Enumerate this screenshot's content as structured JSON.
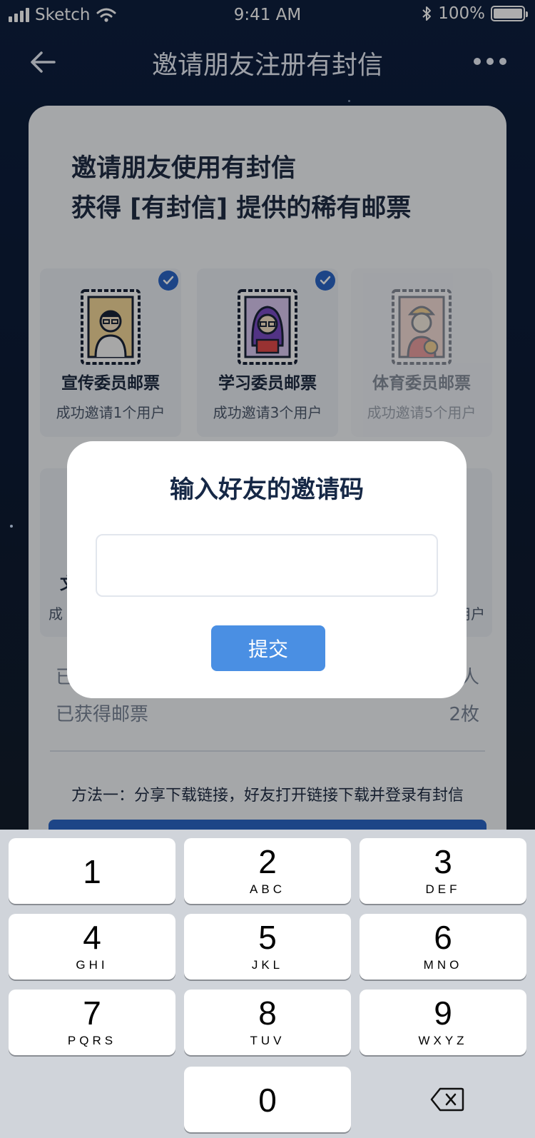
{
  "status_bar": {
    "carrier": "Sketch",
    "time": "9:41 AM",
    "battery": "100%"
  },
  "nav": {
    "title": "邀请朋友注册有封信"
  },
  "card": {
    "headline_line1": "邀请朋友使用有封信",
    "headline_line2": "获得 [有封信] 提供的稀有邮票",
    "stamps": [
      {
        "name": "宣传委员邮票",
        "condition": "成功邀请1个用户",
        "unlocked": true
      },
      {
        "name": "学习委员邮票",
        "condition": "成功邀请3个用户",
        "unlocked": true
      },
      {
        "name": "体育委员邮票",
        "condition": "成功邀请5个用户",
        "unlocked": false
      }
    ],
    "second_row_partial": {
      "left_name_fragment": "文",
      "left_cond_fragment": "成",
      "right_cond_fragment": "用户"
    },
    "stats": [
      {
        "label": "已",
        "value": "人"
      },
      {
        "label": "已获得邮票",
        "value": "2枚"
      }
    ],
    "method_one": "方法一：分享下载链接，好友打开链接下载并登录有封信"
  },
  "dialog": {
    "title": "输入好友的邀请码",
    "input_value": "",
    "submit_label": "提交"
  },
  "keypad": {
    "keys": [
      {
        "num": "1",
        "letters": ""
      },
      {
        "num": "2",
        "letters": "ABC"
      },
      {
        "num": "3",
        "letters": "DEF"
      },
      {
        "num": "4",
        "letters": "GHI"
      },
      {
        "num": "5",
        "letters": "JKL"
      },
      {
        "num": "6",
        "letters": "MNO"
      },
      {
        "num": "7",
        "letters": "PQRS"
      },
      {
        "num": "8",
        "letters": "TUV"
      },
      {
        "num": "9",
        "letters": "WXYZ"
      },
      {
        "num": "0",
        "letters": ""
      }
    ],
    "delete_icon": "backspace-icon"
  },
  "colors": {
    "accent": "#4a8fe3",
    "check": "#2b66c8",
    "background": "#0e1f3f"
  }
}
